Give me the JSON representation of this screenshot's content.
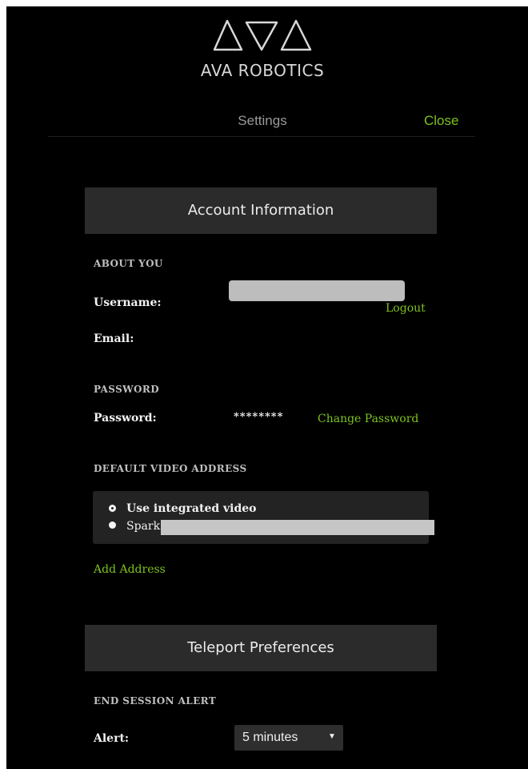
{
  "brand": {
    "name": "AVA ROBOTICS",
    "accent_color": "#7ec11f",
    "logo_icon": "ava-triangles-logo-icon"
  },
  "header": {
    "title": "Settings",
    "close_label": "Close"
  },
  "account": {
    "section_title": "Account Information",
    "about_you_heading": "ABOUT YOU",
    "username_label": "Username:",
    "email_label": "Email:",
    "logout_label": "Logout",
    "password_heading": "PASSWORD",
    "password_label": "Password:",
    "password_value": "********",
    "change_password_label": "Change Password",
    "video_heading": "DEFAULT VIDEO ADDRESS",
    "video_options": [
      {
        "label": "Use integrated video",
        "selected": true
      },
      {
        "label": "Spark",
        "selected": false
      }
    ],
    "add_address_label": "Add Address"
  },
  "teleport": {
    "section_title": "Teleport Preferences",
    "end_session_heading": "END SESSION ALERT",
    "alert_label": "Alert:",
    "alert_value": "5 minutes",
    "caret_icon": "caret-down-icon"
  }
}
